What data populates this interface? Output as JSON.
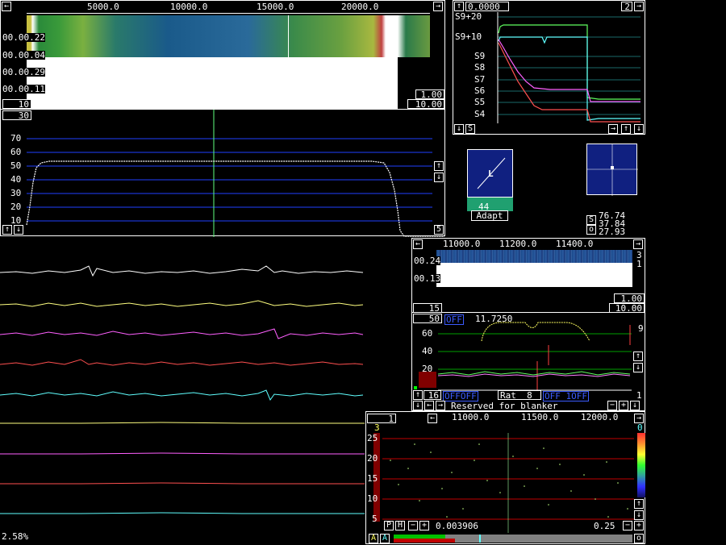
{
  "waterfall_main": {
    "freq_ticks": [
      "5000.0",
      "10000.0",
      "15000.0",
      "20000.0"
    ],
    "time_labels": [
      "00.00.22",
      "00.00.04",
      "00.00.29",
      "00.00.11"
    ],
    "box_left": "10",
    "box_right_top": "1.00",
    "box_right_bottom": "10.00"
  },
  "spectrum_main": {
    "box_top": "30",
    "y_ticks": [
      "70",
      "60",
      "50",
      "40",
      "30",
      "20",
      "10"
    ],
    "box_bottom_right": "5"
  },
  "smeter": {
    "value": "0.0000",
    "box_right": "2",
    "labels": [
      "S9+20",
      "S9+10",
      "S9",
      "S8",
      "S7",
      "S6",
      "S5",
      "S4"
    ],
    "bottom_button": "S"
  },
  "adapt": {
    "letter": "L",
    "value": "44",
    "button_label": "Adapt"
  },
  "polar": {
    "button_s": "S",
    "button_o": "o",
    "values": [
      "76.74",
      "37.84",
      "27.93"
    ]
  },
  "baseband": {
    "freq_ticks": [
      "11000.0",
      "11200.0",
      "11400.0"
    ],
    "time_labels": [
      "00.24",
      "00.13"
    ],
    "right_nums": [
      "3",
      "1"
    ],
    "box_right_top": "1.00",
    "box_right_bottom": "10.00",
    "box_left": "15"
  },
  "baseband_spectrum": {
    "box_left": "50",
    "off_tag": "OFF",
    "freq_value": "11.7250",
    "y_ticks": [
      "60",
      "40",
      "20"
    ],
    "right_num": "9",
    "bottom_left_box": "16",
    "status_tag1": "OFFOFF",
    "rat_label": "Rat",
    "rat_value": "8",
    "status_tag2": "OFF 1OFF",
    "right_bottom_num": "1",
    "reserved_text": "Reserved for blanker"
  },
  "hires": {
    "box_left": "1",
    "freq_ticks": [
      "11000.0",
      "11500.0",
      "12000.0"
    ],
    "top_left_num": "3",
    "top_right_num": "0",
    "y_ticks": [
      "25",
      "20",
      "15",
      "10",
      "5"
    ],
    "buttons": [
      "P",
      "H"
    ],
    "bottom_value": "0.003906",
    "bottom_right_value": "0.25",
    "bottom_buttons": [
      "A",
      "A"
    ],
    "bottom_right_button": "o"
  },
  "status": {
    "cpu_load": "2.58%"
  },
  "colors": {
    "grid_blue": "#2040ff",
    "grid_green": "#00a000",
    "grid_red": "#c00000",
    "trace_white": "#ffffff",
    "trace_yellow": "#ffff80",
    "trace_magenta": "#ff60ff",
    "trace_red": "#ff5050",
    "trace_cyan": "#60ffff"
  },
  "icons": {
    "arrow_left": "←",
    "arrow_right": "→",
    "arrow_up": "↑",
    "arrow_down": "↓",
    "minus": "−",
    "plus": "+"
  }
}
